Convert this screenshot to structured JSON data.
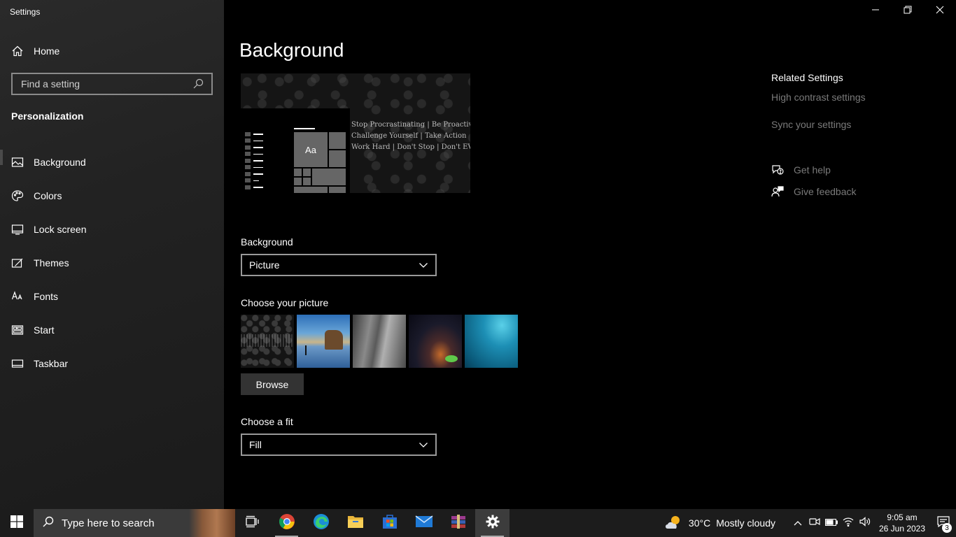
{
  "window": {
    "title": "Settings"
  },
  "sidebar": {
    "home_label": "Home",
    "search_placeholder": "Find a setting",
    "section_title": "Personalization",
    "items": [
      {
        "label": "Background",
        "icon": "picture-icon",
        "active": true
      },
      {
        "label": "Colors",
        "icon": "palette-icon"
      },
      {
        "label": "Lock screen",
        "icon": "lock-screen-icon"
      },
      {
        "label": "Themes",
        "icon": "themes-brush-icon"
      },
      {
        "label": "Fonts",
        "icon": "fonts-icon"
      },
      {
        "label": "Start",
        "icon": "start-icon"
      },
      {
        "label": "Taskbar",
        "icon": "taskbar-icon"
      }
    ]
  },
  "main": {
    "page_title": "Background",
    "preview": {
      "tile_text": "Aa",
      "wallpaper_lines": [
        "Stop Procrastinating | Be Proactive | Make Plans",
        "Challenge Yourself | Take Action",
        "Work Hard | Don't Stop | Don't EVER Quit"
      ]
    },
    "background_label": "Background",
    "background_value": "Picture",
    "choose_picture_label": "Choose your picture",
    "browse_label": "Browse",
    "fit_label": "Choose a fit",
    "fit_value": "Fill"
  },
  "related": {
    "title": "Related Settings",
    "high_contrast": "High contrast settings",
    "sync": "Sync your settings",
    "get_help": "Get help",
    "give_feedback": "Give feedback"
  },
  "taskbar": {
    "search_placeholder": "Type here to search",
    "weather_temp": "30°C",
    "weather_text": "Mostly cloudy",
    "time": "9:05 am",
    "date": "26 Jun 2023",
    "notification_count": "3"
  },
  "colors": {
    "sidebar_bg": "#222222",
    "main_bg": "#000000",
    "taskbar_bg": "#1c1c1c",
    "muted_link": "#7a7a7a"
  }
}
